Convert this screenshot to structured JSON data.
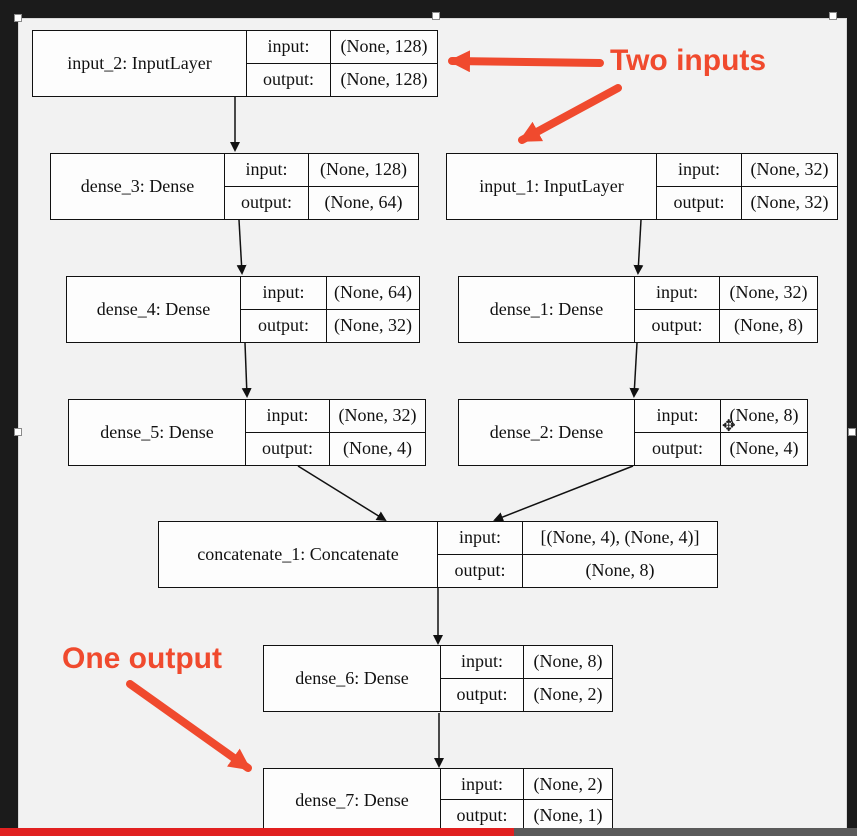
{
  "annotations": {
    "two_inputs": "Two inputs",
    "one_output": "One output"
  },
  "io_labels": {
    "input": "input:",
    "output": "output:"
  },
  "nodes": {
    "input_2": {
      "name": "input_2: InputLayer",
      "input": "(None, 128)",
      "output": "(None, 128)"
    },
    "dense_3": {
      "name": "dense_3: Dense",
      "input": "(None, 128)",
      "output": "(None, 64)"
    },
    "input_1": {
      "name": "input_1: InputLayer",
      "input": "(None, 32)",
      "output": "(None, 32)"
    },
    "dense_4": {
      "name": "dense_4: Dense",
      "input": "(None, 64)",
      "output": "(None, 32)"
    },
    "dense_1": {
      "name": "dense_1: Dense",
      "input": "(None, 32)",
      "output": "(None, 8)"
    },
    "dense_5": {
      "name": "dense_5: Dense",
      "input": "(None, 32)",
      "output": "(None, 4)"
    },
    "dense_2": {
      "name": "dense_2: Dense",
      "input": "(None, 8)",
      "output": "(None, 4)"
    },
    "concatenate_1": {
      "name": "concatenate_1: Concatenate",
      "input": "[(None, 4), (None, 4)]",
      "output": "(None, 8)"
    },
    "dense_6": {
      "name": "dense_6: Dense",
      "input": "(None, 8)",
      "output": "(None, 2)"
    },
    "dense_7": {
      "name": "dense_7: Dense",
      "input": "(None, 2)",
      "output": "(None, 1)"
    }
  },
  "colors": {
    "annotation": "#f04a2e",
    "progress": "#e12020"
  },
  "video_progress": 0.6
}
